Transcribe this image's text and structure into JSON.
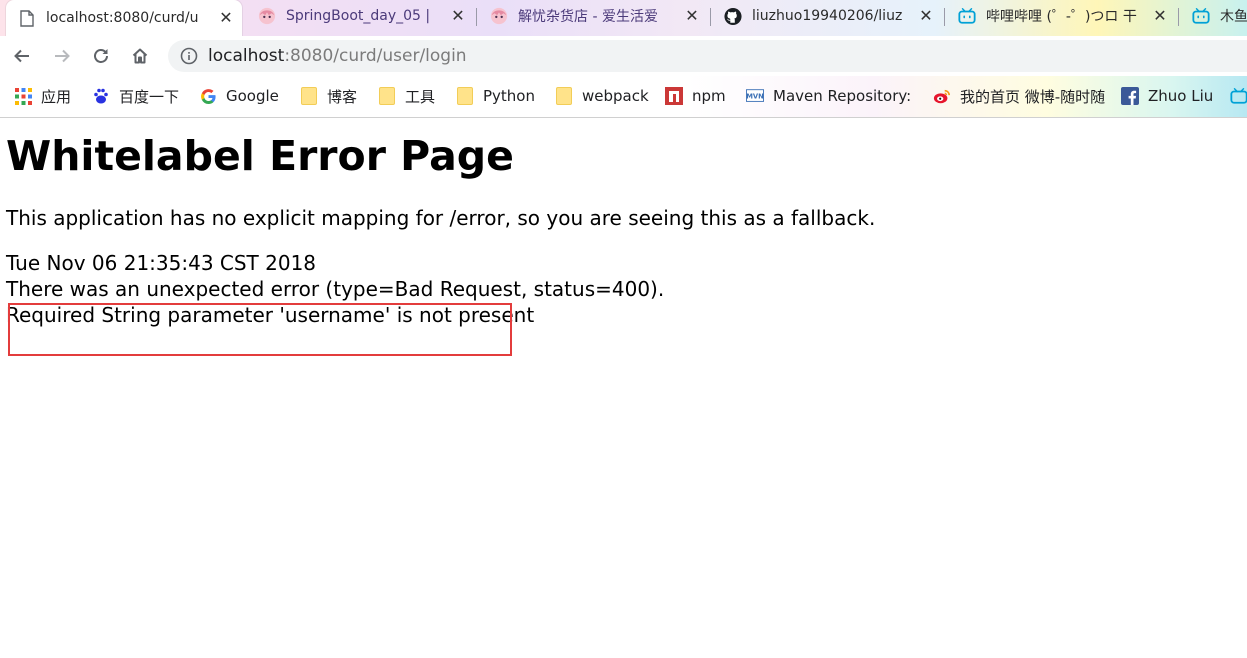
{
  "tabs": [
    {
      "title": "localhost:8080/curd/u",
      "active": true,
      "icon": "page-icon"
    },
    {
      "title": "SpringBoot_day_05 | ",
      "active": false,
      "icon": "anime-avatar-icon"
    },
    {
      "title": "解忧杂货店 - 爱生活爱",
      "active": false,
      "icon": "anime-avatar-icon"
    },
    {
      "title": "liuzhuo19940206/liuz",
      "active": false,
      "icon": "github-icon"
    },
    {
      "title": "哔哩哔哩 (゜-゜)つロ 干",
      "active": false,
      "icon": "bilibili-icon"
    },
    {
      "title": "木鱼",
      "active": false,
      "icon": "bilibili-icon"
    }
  ],
  "tab_close_glyph": "✕",
  "address": {
    "host": "localhost",
    "rest": ":8080/curd/user/login"
  },
  "bookmarks": [
    {
      "label": "应用",
      "icon": "apps-grid-icon"
    },
    {
      "label": "百度一下",
      "icon": "baidu-icon"
    },
    {
      "label": "Google",
      "icon": "google-icon"
    },
    {
      "label": "博客",
      "icon": "folder-icon"
    },
    {
      "label": "工具",
      "icon": "folder-icon"
    },
    {
      "label": "Python",
      "icon": "folder-icon"
    },
    {
      "label": "webpack",
      "icon": "folder-icon"
    },
    {
      "label": "npm",
      "icon": "npm-icon"
    },
    {
      "label": "Maven Repository: S",
      "icon": "mvn-icon"
    },
    {
      "label": "我的首页 微博-随时随",
      "icon": "weibo-icon"
    },
    {
      "label": "Zhuo Liu",
      "icon": "facebook-icon"
    }
  ],
  "page": {
    "heading": "Whitelabel Error Page",
    "fallback_message": "This application has no explicit mapping for /error, so you are seeing this as a fallback.",
    "timestamp": "Tue Nov 06 21:35:43 CST 2018",
    "error_line": "There was an unexpected error (type=Bad Request, status=400).",
    "detail": "Required String parameter 'username' is not present"
  },
  "colors": {
    "highlight_border": "#e33c3c",
    "bilibili": "#00a1d6"
  }
}
